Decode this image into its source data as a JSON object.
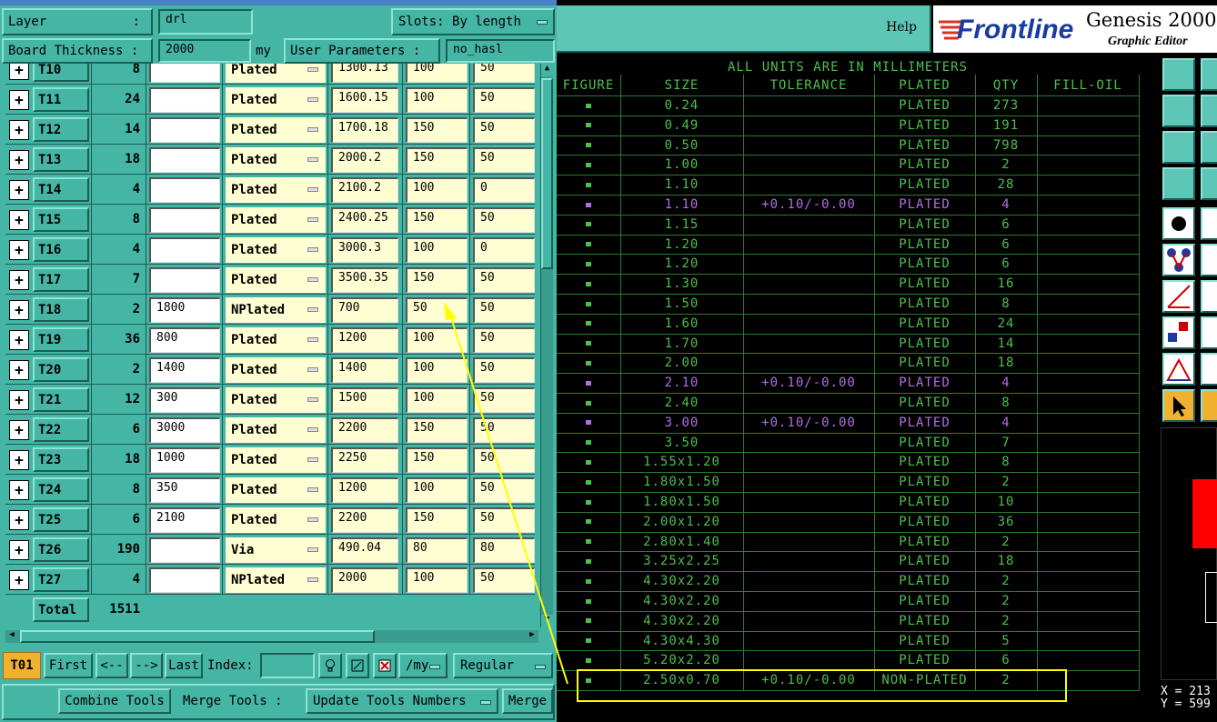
{
  "left": {
    "layer_label": "Layer",
    "layer_sep": ":",
    "layer_value": "drl",
    "slots_label": "Slots:",
    "slots_value": "By length",
    "board_label": "Board Thickness :",
    "board_value": "2000",
    "board_unit": "my",
    "userparam_label": "User Parameters :",
    "userparam_value": "no_hasl",
    "rows": [
      {
        "tool": "T10",
        "count": "8",
        "finish": "",
        "type": "Plated",
        "drill": "1300.13",
        "tp": "100",
        "tm": "50"
      },
      {
        "tool": "T11",
        "count": "24",
        "finish": "",
        "type": "Plated",
        "drill": "1600.15",
        "tp": "100",
        "tm": "50"
      },
      {
        "tool": "T12",
        "count": "14",
        "finish": "",
        "type": "Plated",
        "drill": "1700.18",
        "tp": "150",
        "tm": "50"
      },
      {
        "tool": "T13",
        "count": "18",
        "finish": "",
        "type": "Plated",
        "drill": "2000.2",
        "tp": "150",
        "tm": "50"
      },
      {
        "tool": "T14",
        "count": "4",
        "finish": "",
        "type": "Plated",
        "drill": "2100.2",
        "tp": "100",
        "tm": "0"
      },
      {
        "tool": "T15",
        "count": "8",
        "finish": "",
        "type": "Plated",
        "drill": "2400.25",
        "tp": "150",
        "tm": "50"
      },
      {
        "tool": "T16",
        "count": "4",
        "finish": "",
        "type": "Plated",
        "drill": "3000.3",
        "tp": "100",
        "tm": "0"
      },
      {
        "tool": "T17",
        "count": "7",
        "finish": "",
        "type": "Plated",
        "drill": "3500.35",
        "tp": "150",
        "tm": "50"
      },
      {
        "tool": "T18",
        "count": "2",
        "finish": "1800",
        "type": "NPlated",
        "drill": "700",
        "tp": "50",
        "tm": "50"
      },
      {
        "tool": "T19",
        "count": "36",
        "finish": "800",
        "type": "Plated",
        "drill": "1200",
        "tp": "100",
        "tm": "50"
      },
      {
        "tool": "T20",
        "count": "2",
        "finish": "1400",
        "type": "Plated",
        "drill": "1400",
        "tp": "100",
        "tm": "50"
      },
      {
        "tool": "T21",
        "count": "12",
        "finish": "300",
        "type": "Plated",
        "drill": "1500",
        "tp": "100",
        "tm": "50"
      },
      {
        "tool": "T22",
        "count": "6",
        "finish": "3000",
        "type": "Plated",
        "drill": "2200",
        "tp": "150",
        "tm": "50"
      },
      {
        "tool": "T23",
        "count": "18",
        "finish": "1000",
        "type": "Plated",
        "drill": "2250",
        "tp": "150",
        "tm": "50"
      },
      {
        "tool": "T24",
        "count": "8",
        "finish": "350",
        "type": "Plated",
        "drill": "1200",
        "tp": "100",
        "tm": "50"
      },
      {
        "tool": "T25",
        "count": "6",
        "finish": "2100",
        "type": "Plated",
        "drill": "2200",
        "tp": "150",
        "tm": "50"
      },
      {
        "tool": "T26",
        "count": "190",
        "finish": "",
        "type": "Via",
        "drill": "490.04",
        "tp": "80",
        "tm": "80"
      },
      {
        "tool": "T27",
        "count": "4",
        "finish": "",
        "type": "NPlated",
        "drill": "2000",
        "tp": "100",
        "tm": "50"
      }
    ],
    "total_label": "Total",
    "total_value": "1511",
    "nav": {
      "current": "T01",
      "first": "First",
      "prev": "<--",
      "next": "-->",
      "last": "Last",
      "index_label": "Index:",
      "unit": "/my",
      "mode": "Regular"
    },
    "bottom": {
      "combine": "Combine Tools",
      "merge_label": "Merge Tools :",
      "merge_value": "Update Tools Numbers",
      "merge": "Merge"
    }
  },
  "right": {
    "help": "Help",
    "brand": "Frontline",
    "product": "Genesis 2000",
    "product_sub": "Graphic Editor",
    "report_title": "ALL UNITS ARE IN MILLIMETERS",
    "headers": [
      "FIGURE",
      "SIZE",
      "TOLERANCE",
      "PLATED",
      "QTY",
      "FILL-OIL"
    ],
    "rows": [
      {
        "size": "0.24",
        "tol": "",
        "plated": "PLATED",
        "qty": "273",
        "hl": false
      },
      {
        "size": "0.49",
        "tol": "",
        "plated": "PLATED",
        "qty": "191",
        "hl": false
      },
      {
        "size": "0.50",
        "tol": "",
        "plated": "PLATED",
        "qty": "798",
        "hl": false
      },
      {
        "size": "1.00",
        "tol": "",
        "plated": "PLATED",
        "qty": "2",
        "hl": false
      },
      {
        "size": "1.10",
        "tol": "",
        "plated": "PLATED",
        "qty": "28",
        "hl": false
      },
      {
        "size": "1.10",
        "tol": "+0.10/-0.00",
        "plated": "PLATED",
        "qty": "4",
        "hl": true
      },
      {
        "size": "1.15",
        "tol": "",
        "plated": "PLATED",
        "qty": "6",
        "hl": false
      },
      {
        "size": "1.20",
        "tol": "",
        "plated": "PLATED",
        "qty": "6",
        "hl": false
      },
      {
        "size": "1.20",
        "tol": "",
        "plated": "PLATED",
        "qty": "6",
        "hl": false
      },
      {
        "size": "1.30",
        "tol": "",
        "plated": "PLATED",
        "qty": "16",
        "hl": false
      },
      {
        "size": "1.50",
        "tol": "",
        "plated": "PLATED",
        "qty": "8",
        "hl": false
      },
      {
        "size": "1.60",
        "tol": "",
        "plated": "PLATED",
        "qty": "24",
        "hl": false
      },
      {
        "size": "1.70",
        "tol": "",
        "plated": "PLATED",
        "qty": "14",
        "hl": false
      },
      {
        "size": "2.00",
        "tol": "",
        "plated": "PLATED",
        "qty": "18",
        "hl": false
      },
      {
        "size": "2.10",
        "tol": "+0.10/-0.00",
        "plated": "PLATED",
        "qty": "4",
        "hl": true
      },
      {
        "size": "2.40",
        "tol": "",
        "plated": "PLATED",
        "qty": "8",
        "hl": false
      },
      {
        "size": "3.00",
        "tol": "+0.10/-0.00",
        "plated": "PLATED",
        "qty": "4",
        "hl": true
      },
      {
        "size": "3.50",
        "tol": "",
        "plated": "PLATED",
        "qty": "7",
        "hl": false
      },
      {
        "size": "1.55x1.20",
        "tol": "",
        "plated": "PLATED",
        "qty": "8",
        "hl": false
      },
      {
        "size": "1.80x1.50",
        "tol": "",
        "plated": "PLATED",
        "qty": "2",
        "hl": false
      },
      {
        "size": "1.80x1.50",
        "tol": "",
        "plated": "PLATED",
        "qty": "10",
        "hl": false
      },
      {
        "size": "2.00x1.20",
        "tol": "",
        "plated": "PLATED",
        "qty": "36",
        "hl": false
      },
      {
        "size": "2.80x1.40",
        "tol": "",
        "plated": "PLATED",
        "qty": "2",
        "hl": false
      },
      {
        "size": "3.25x2.25",
        "tol": "",
        "plated": "PLATED",
        "qty": "18",
        "hl": false
      },
      {
        "size": "4.30x2.20",
        "tol": "",
        "plated": "PLATED",
        "qty": "2",
        "hl": false
      },
      {
        "size": "4.30x2.20",
        "tol": "",
        "plated": "PLATED",
        "qty": "2",
        "hl": false
      },
      {
        "size": "4.30x2.20",
        "tol": "",
        "plated": "PLATED",
        "qty": "2",
        "hl": false
      },
      {
        "size": "4.30x4.30",
        "tol": "",
        "plated": "PLATED",
        "qty": "5",
        "hl": false
      },
      {
        "size": "5.20x2.20",
        "tol": "",
        "plated": "PLATED",
        "qty": "6",
        "hl": false
      },
      {
        "size": "2.50x0.70",
        "tol": "+0.10/-0.00",
        "plated": "NON-PLATED",
        "qty": "2",
        "hl": false
      }
    ],
    "coord_x": "X = 213",
    "coord_y": "Y = 599"
  },
  "colors": {
    "panel": "#45b5a5",
    "cream": "#fefed2",
    "green_text": "#4fbf4f",
    "purple_text": "#b070e0",
    "annotation": "#ffff00"
  }
}
